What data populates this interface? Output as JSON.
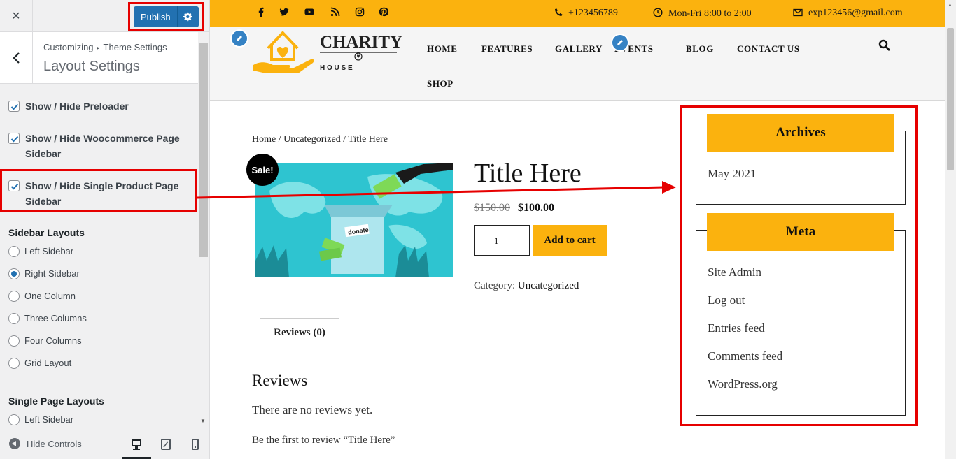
{
  "customizer": {
    "close_label": "×",
    "publish_label": "Publish",
    "breadcrumb": {
      "root": "Customizing",
      "sep": "▸",
      "section": "Theme Settings"
    },
    "section_title": "Layout Settings",
    "checkboxes": [
      {
        "label": "Show / Hide Preloader",
        "checked": true
      },
      {
        "label": "Show / Hide Woocommerce Page Sidebar",
        "checked": true
      },
      {
        "label": "Show / Hide Single Product Page Sidebar",
        "checked": true
      }
    ],
    "sidebar_layouts": {
      "label": "Sidebar Layouts",
      "options": [
        "Left Sidebar",
        "Right Sidebar",
        "One Column",
        "Three Columns",
        "Four Columns",
        "Grid Layout"
      ],
      "selected": "Right Sidebar"
    },
    "single_page_layouts": {
      "label": "Single Page Layouts",
      "options": [
        "Left Sidebar"
      ]
    },
    "footer": {
      "hide_controls": "Hide Controls",
      "device_selected": "desktop"
    }
  },
  "site": {
    "topbar": {
      "phone": "+123456789",
      "hours": "Mon-Fri 8:00 to 2:00",
      "email": "exp123456@gmail.com",
      "social_icons": [
        "facebook-icon",
        "twitter-icon",
        "youtube-icon",
        "rss-icon",
        "instagram-icon",
        "pinterest-icon"
      ]
    },
    "logo": {
      "line1": "CHARITY",
      "line2": "H O U S E"
    },
    "nav": [
      "HOME",
      "FEATURES",
      "GALLERY",
      "EVENTS",
      "BLOG",
      "CONTACT US",
      "SHOP"
    ],
    "product": {
      "breadcrumb": "Home / Uncategorized / Title Here",
      "sale_badge": "Sale!",
      "image_text": "donate",
      "title": "Title Here",
      "old_price": "$150.00",
      "new_price": "$100.00",
      "quantity": "1",
      "add_to_cart": "Add to cart",
      "category_label": "Category:",
      "category": "Uncategorized",
      "tab": "Reviews (0)",
      "reviews_heading": "Reviews",
      "no_reviews": "There are no reviews yet.",
      "be_first": "Be the first to review “Title Here”"
    },
    "sidebar": {
      "archives": {
        "title": "Archives",
        "items": [
          "May 2021"
        ]
      },
      "meta": {
        "title": "Meta",
        "items": [
          "Site Admin",
          "Log out",
          "Entries feed",
          "Comments feed",
          "WordPress.org"
        ]
      }
    }
  },
  "colors": {
    "accent": "#fbb20e",
    "wp_blue": "#2271b1",
    "annotation_red": "#e60000"
  }
}
